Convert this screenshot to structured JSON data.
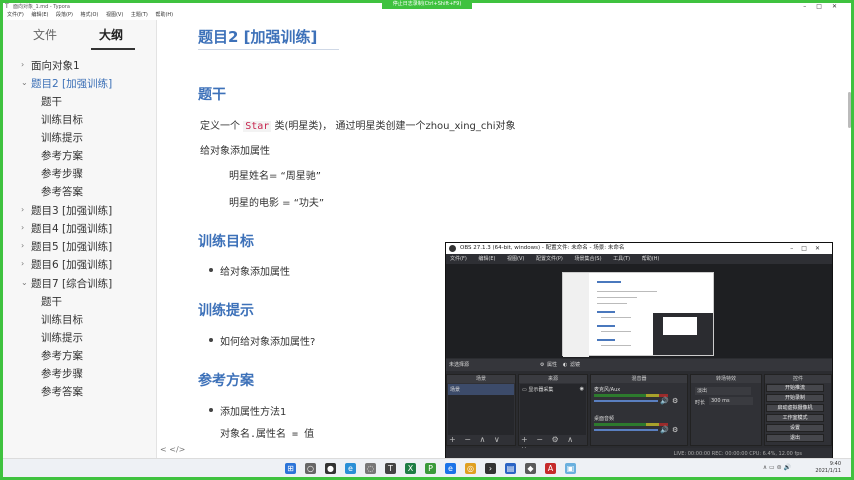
{
  "window": {
    "title": "面向对象_1.md - Typora",
    "recording_tag": "停止日志录制(Ctrl+Shift+F9)"
  },
  "menubar": [
    "文件(F)",
    "编辑(E)",
    "段落(P)",
    "格式(O)",
    "视图(V)",
    "主题(T)",
    "帮助(H)"
  ],
  "sidebar": {
    "tabs": [
      "文件",
      "大纲"
    ],
    "outline": [
      "面向对象1",
      "题目2 [加强训练]",
      "题干",
      "训练目标",
      "训练提示",
      "参考方案",
      "参考步骤",
      "参考答案",
      "题目3 [加强训练]",
      "题目4 [加强训练]",
      "题目5 [加强训练]",
      "题目6 [加强训练]",
      "题目7 [综合训练]",
      "题干",
      "训练目标",
      "训练提示",
      "参考方案",
      "参考步骤",
      "参考答案"
    ],
    "footer": "<   </>"
  },
  "doc": {
    "h_title": "题目2 [加强训练]",
    "h_stem": "题干",
    "stem_p1_a": "定义一个",
    "stem_p1_code": "Star",
    "stem_p1_b": "类(明星类)， 通过明星类创建一个zhou_xing_chi对象",
    "stem_p2": "给对象添加属性",
    "stem_p3": "明星姓名= “周星驰”",
    "stem_p4": "明星的电影 = “功夫”",
    "h_goal": "训练目标",
    "goal_item": "给对象添加属性",
    "h_hint": "训练提示",
    "hint_item": "如何给对象添加属性?",
    "h_plan": "参考方案",
    "plan_item": "添加属性方法1",
    "plan_code": "对象名.属性名 = 值"
  },
  "obs": {
    "title": "OBS 27.1.3 (64-bit, windows) - 配置文件: 未命名 - 场景: 未命名",
    "menu": [
      "文件(F)",
      "编辑(E)",
      "视图(V)",
      "配置文件(P)",
      "场景集合(S)",
      "工具(T)",
      "帮助(H)"
    ],
    "srcbar": "未选择源",
    "srcbar_props": "属性",
    "srcbar_filters": "滤镜",
    "panels": [
      "场景",
      "来源",
      "混音器",
      "转场特效",
      "控件"
    ],
    "scene_item": "场景",
    "source_item": "显示器采集",
    "mixer_1": "麦克风/Aux",
    "mixer_2": "桌面音频",
    "transition": "淡出",
    "duration_label": "时长",
    "duration_value": "300 ms",
    "controls": [
      "开始推流",
      "开始录制",
      "启动虚拟摄像机",
      "工作室模式",
      "设置",
      "退出"
    ],
    "status": "LIVE: 00:00:00    REC: 00:00:00    CPU: 6.4%, 12.00 fps"
  },
  "taskbar": {
    "time": "9:40",
    "date": "2021/1/11"
  }
}
